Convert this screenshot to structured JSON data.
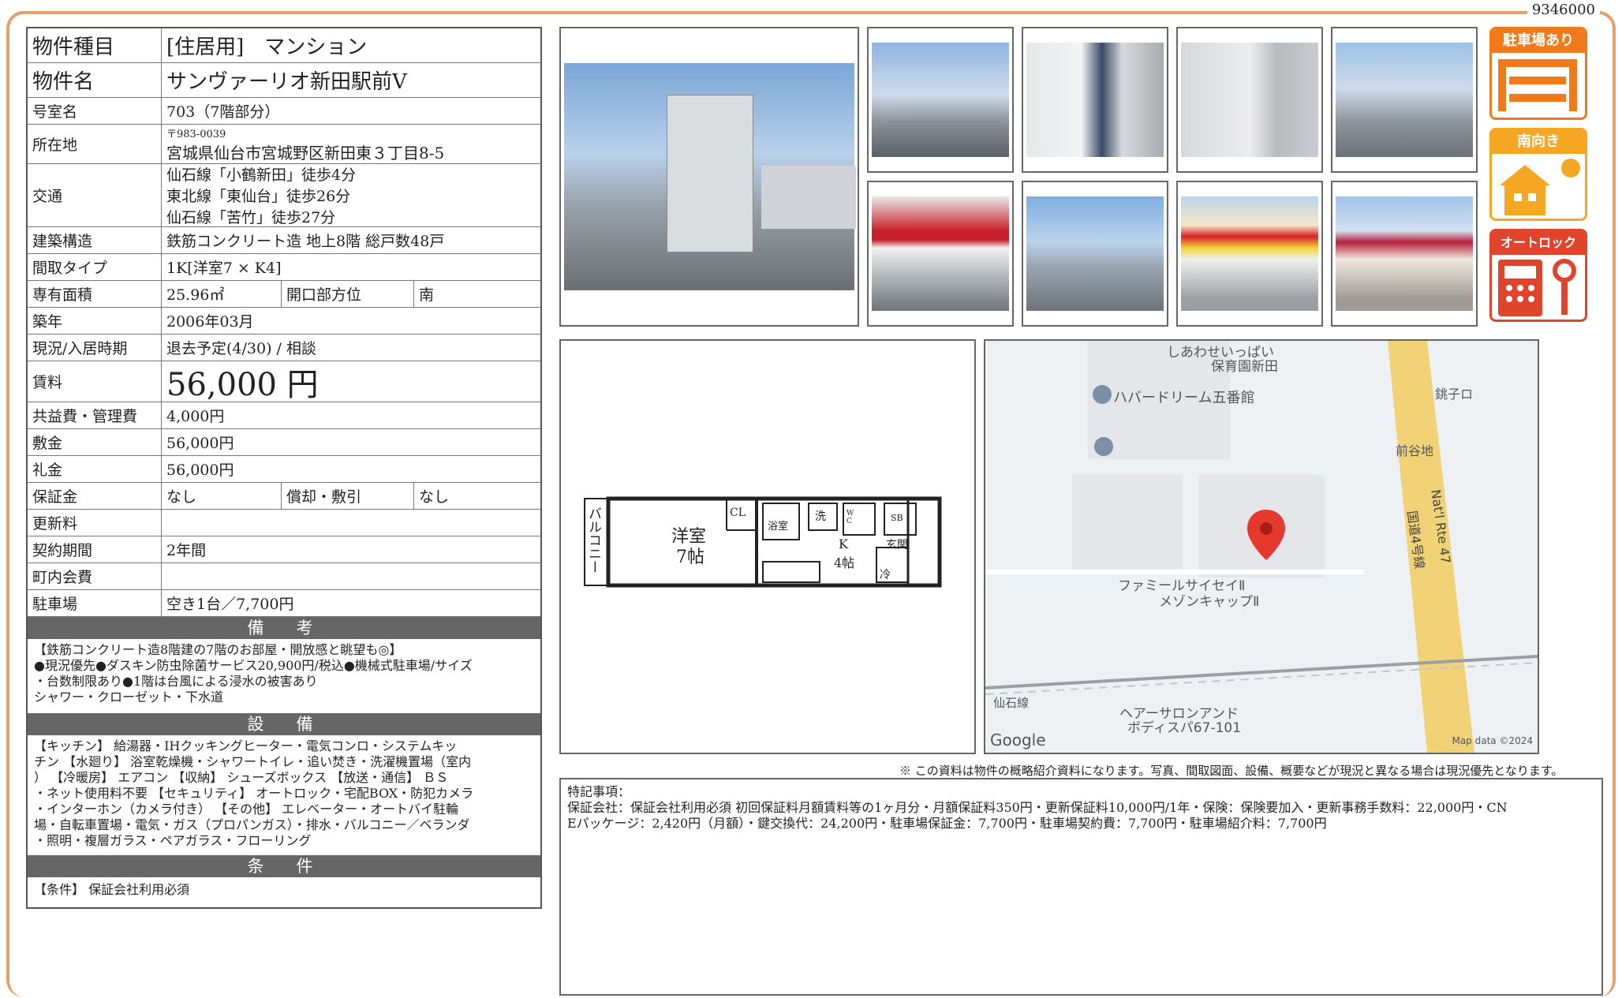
{
  "doc_id": "9346000",
  "table": {
    "type_label": "物件種目",
    "type_value": "[住居用]　マンション",
    "name_label": "物件名",
    "name_value": "サンヴァーリオ新田駅前Ⅴ",
    "room_label": "号室名",
    "room_value": "703（7階部分）",
    "address_label": "所在地",
    "postal": "〒983-0039",
    "address": "宮城県仙台市宮城野区新田東３丁目8-5",
    "access_label": "交通",
    "access": [
      "仙石線「小鶴新田」徒歩4分",
      "東北線「東仙台」徒歩26分",
      "仙石線「苦竹」徒歩27分"
    ],
    "structure_label": "建築構造",
    "structure_value": "鉄筋コンクリート造 地上8階 総戸数48戸",
    "layout_label": "間取タイプ",
    "layout_value": "1K[洋室7 × K4]",
    "area_label": "専有面積",
    "area_value": "25.96㎡",
    "direction_label": "開口部方位",
    "direction_value": "南",
    "built_label": "築年",
    "built_value": "2006年03月",
    "status_label": "現況/入居時期",
    "status_value": "退去予定(4/30) / 相談",
    "rent_label": "賃料",
    "rent_value": "56,000 円",
    "fee_label": "共益費・管理費",
    "fee_value": "4,000円",
    "deposit_label": "敷金",
    "deposit_value": "56,000円",
    "key_label": "礼金",
    "key_value": "56,000円",
    "guarantee_label": "保証金",
    "guarantee_value": "なし",
    "amort_label": "償却・敷引",
    "amort_value": "なし",
    "renew_label": "更新料",
    "renew_value": "",
    "term_label": "契約期間",
    "term_value": "2年間",
    "town_label": "町内会費",
    "town_value": "",
    "parking_label": "駐車場",
    "parking_value": "空き1台／7,700円"
  },
  "bikou": {
    "title": "備　考",
    "lines": [
      "【鉄筋コンクリート造8階建の7階のお部屋・開放感と眺望も◎】",
      "●現況優先●ダスキン防虫除菌サービス20,900円/税込●機械式駐車場/サイズ",
      "・台数制限あり●1階は台風による浸水の被害あり",
      "シャワー・クローゼット・下水道"
    ]
  },
  "setsubi": {
    "title": "設　備",
    "lines": [
      "【キッチン】 給湯器・IHクッキングヒーター・電気コンロ・システムキッ",
      "チン 【水廻り】 浴室乾燥機・シャワートイレ・追い焚き・洗濯機置場（室内",
      "） 【冷暖房】 エアコン 【収納】 シューズボックス 【放送・通信】 ＢＳ",
      "・ネット使用料不要 【セキュリティ】 オートロック・宅配BOX・防犯カメラ",
      "・インターホン（カメラ付き） 【その他】 エレベーター・オートバイ駐輪",
      "場・自転車置場・電気・ガス（プロパンガス）・排水・バルコニー／ベランダ",
      "・照明・複層ガラス・ペアガラス・フローリング"
    ]
  },
  "jouken": {
    "title": "条　件",
    "text": "【条件】 保証会社利用必須"
  },
  "features": [
    {
      "label": "駐車場あり",
      "color": "#f07a1a"
    },
    {
      "label": "南向き",
      "color": "#f5a623"
    },
    {
      "label": "オートロック",
      "color": "#e0442c"
    }
  ],
  "floorplan": {
    "balcony": "バルコニー",
    "room": "洋室",
    "room_size": "7帖",
    "k": "K",
    "k_size": "4帖",
    "cl": "CL",
    "bath": "浴室",
    "wash": "洗",
    "wc": "W C",
    "sb": "SB",
    "entrance": "玄関",
    "fridge": "冷"
  },
  "map": {
    "labels": [
      "しあわせいっぱい",
      "保育園新田",
      "ハバードリーム五番館",
      "銚子ロ",
      "前谷地",
      "Nat'l Rte 47",
      "国道4号線",
      "ファミールサイセイⅡ",
      "メゾンキャップⅡ",
      "ヘアーサロンアンド",
      "ボディスパ67-101",
      "仙石線"
    ],
    "google": "Google",
    "mapdata": "Map data ©2024"
  },
  "note": "※ この資料は物件の概略紹介資料になります。写真、間取図面、設備、概要などが現況と異なる場合は現況優先となります。",
  "remarks": {
    "title": "特記事項：",
    "lines": [
      "保証会社：保証会社利用必須 初回保証料月額賃料等の1ヶ月分・月額保証料350円・更新保証料10,000円/1年・保険：保険要加入・更新事務手数料：22,000円・CN",
      "Eパッケージ：2,420円（月額）・鍵交換代：24,200円・駐車場保証金：7,700円・駐車場契約費：7,700円・駐車場紹介料：7,700円"
    ]
  }
}
